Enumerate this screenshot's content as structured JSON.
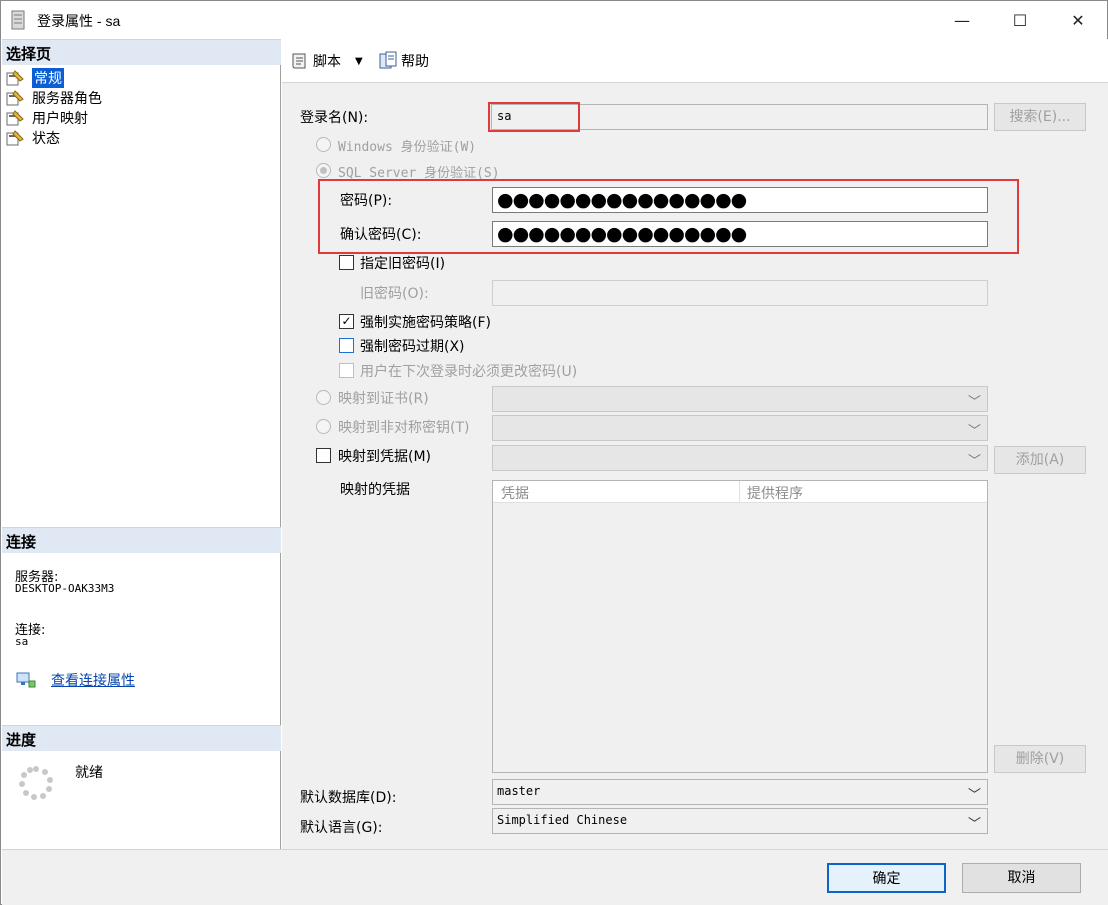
{
  "window": {
    "title": "登录属性 - sa",
    "minimize": "—",
    "maximize": "☐",
    "close": "✕"
  },
  "left": {
    "select_page_heading": "选择页",
    "pages": [
      "常规",
      "服务器角色",
      "用户映射",
      "状态"
    ],
    "connection_heading": "连接",
    "server_label": "服务器:",
    "server_value": "DESKTOP-OAK33M3",
    "connection_label": "连接:",
    "connection_value": "sa",
    "view_connection_link": "查看连接属性",
    "progress_heading": "进度",
    "progress_status": "就绪"
  },
  "toolbar": {
    "script_label": "脚本",
    "help_label": "帮助"
  },
  "form": {
    "login_name_label": "登录名(N):",
    "login_name_value": "sa",
    "search_button": "搜索(E)...",
    "windows_auth": "Windows 身份验证(W)",
    "sql_auth": "SQL Server 身份验证(S)",
    "password_label": "密码(P):",
    "password_mask": "●●●●●●●●●●●●●●●●",
    "confirm_password_label": "确认密码(C):",
    "confirm_password_mask": "●●●●●●●●●●●●●●●●",
    "specify_old_password": "指定旧密码(I)",
    "old_password_label": "旧密码(O):",
    "enforce_policy": "强制实施密码策略(F)",
    "enforce_expiration": "强制密码过期(X)",
    "must_change": "用户在下次登录时必须更改密码(U)",
    "map_to_certificate": "映射到证书(R)",
    "map_to_asym_key": "映射到非对称密钥(T)",
    "map_to_credential": "映射到凭据(M)",
    "add_button": "添加(A)",
    "mapped_credentials_label": "映射的凭据",
    "table_headers": [
      "凭据",
      "提供程序"
    ],
    "remove_button": "删除(V)",
    "default_database_label": "默认数据库(D):",
    "default_database_value": "master",
    "default_language_label": "默认语言(G):",
    "default_language_value": "Simplified Chinese"
  },
  "footer": {
    "ok": "确定",
    "cancel": "取消"
  },
  "colors": {
    "highlight_red": "#e03a3a",
    "selection_blue": "#0b5fd6",
    "section_header": "#dfe8f3",
    "link_blue": "#0645ad"
  }
}
